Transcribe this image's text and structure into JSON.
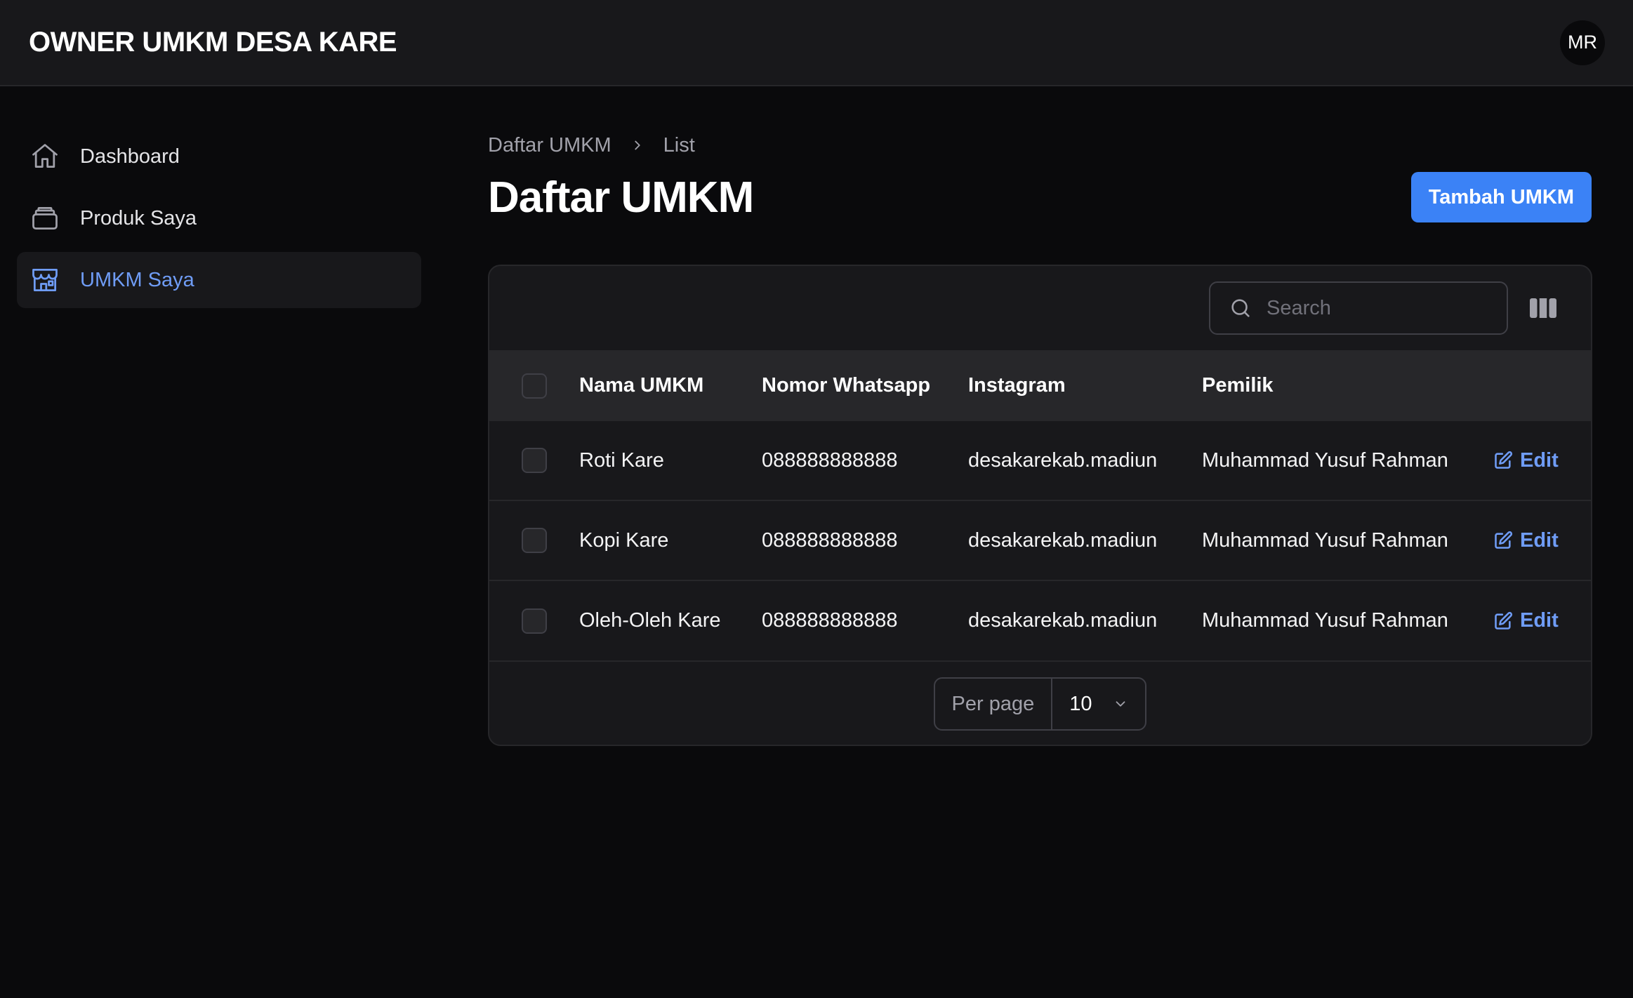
{
  "app": {
    "title": "OWNER UMKM DESA KARE",
    "user_initials": "MR"
  },
  "sidebar": {
    "items": [
      {
        "label": "Dashboard",
        "icon": "home-icon",
        "active": false
      },
      {
        "label": "Produk Saya",
        "icon": "box-icon",
        "active": false
      },
      {
        "label": "UMKM Saya",
        "icon": "store-icon",
        "active": true
      }
    ]
  },
  "breadcrumb": {
    "parent": "Daftar UMKM",
    "current": "List"
  },
  "page": {
    "title": "Daftar UMKM",
    "add_button": "Tambah UMKM"
  },
  "table": {
    "search_placeholder": "Search",
    "columns": [
      "Nama UMKM",
      "Nomor Whatsapp",
      "Instagram",
      "Pemilik"
    ],
    "rows": [
      {
        "nama": "Roti Kare",
        "whatsapp": "088888888888",
        "instagram": "desakarekab.madiun",
        "pemilik": "Muhammad Yusuf Rahman",
        "action": "Edit"
      },
      {
        "nama": "Kopi Kare",
        "whatsapp": "088888888888",
        "instagram": "desakarekab.madiun",
        "pemilik": "Muhammad Yusuf Rahman",
        "action": "Edit"
      },
      {
        "nama": "Oleh-Oleh Kare",
        "whatsapp": "088888888888",
        "instagram": "desakarekab.madiun",
        "pemilik": "Muhammad Yusuf Rahman",
        "action": "Edit"
      }
    ],
    "pagination": {
      "per_page_label": "Per page",
      "per_page_value": "10"
    }
  },
  "colors": {
    "accent": "#3b82f6",
    "active_text": "#6f9cf5",
    "surface": "#18181b",
    "background": "#0a0a0c"
  }
}
